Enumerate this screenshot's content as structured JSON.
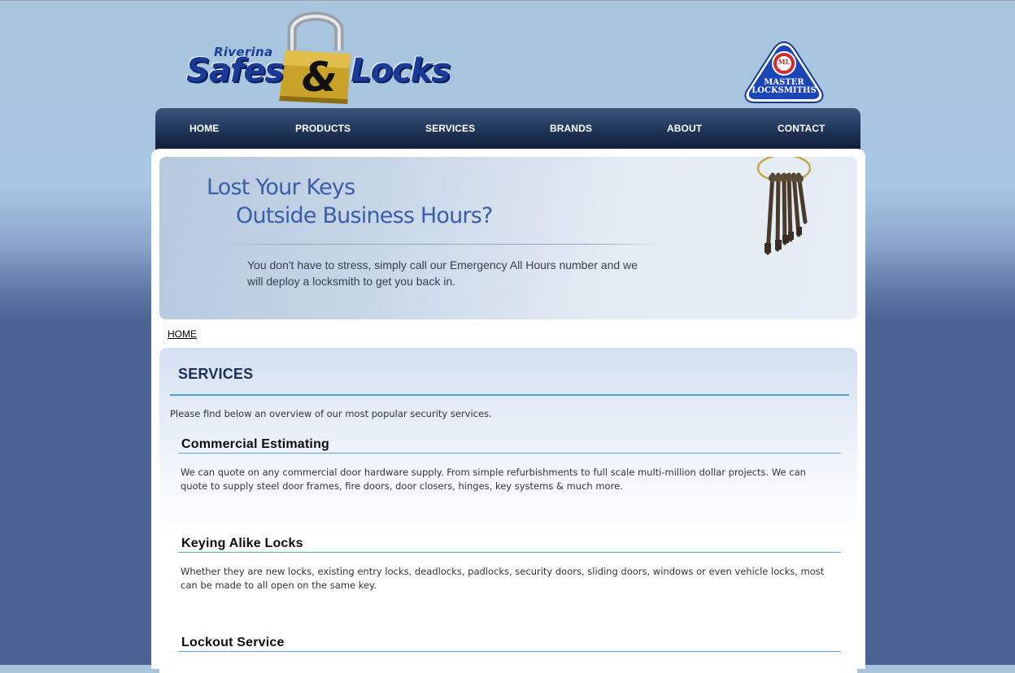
{
  "header": {
    "logo": {
      "line1": "Riverina",
      "word1": "Safes",
      "amp": "&",
      "word2": "Locks"
    },
    "badge": {
      "line1": "MASTER",
      "line2": "LOCKSMITHS",
      "emblem": "ML"
    }
  },
  "nav": {
    "items": [
      {
        "label": "HOME"
      },
      {
        "label": "PRODUCTS"
      },
      {
        "label": "SERVICES"
      },
      {
        "label": "BRANDS"
      },
      {
        "label": "ABOUT"
      },
      {
        "label": "CONTACT"
      }
    ]
  },
  "banner": {
    "title_line1": "Lost Your Keys",
    "title_line2": "Outside Business Hours?",
    "body": "You don't have to stress, simply call our Emergency All Hours number and we will deploy a locksmith to get you back in.",
    "image_icon": "bunch-of-keys"
  },
  "breadcrumb": {
    "home": "HOME"
  },
  "content": {
    "title": "SERVICES",
    "intro": "Please find below an overview of our most popular security services.",
    "services": [
      {
        "title": "Commercial Estimating",
        "desc": "We can quote on any commercial door hardware supply. From simple refurbishments to full scale multi-million dollar projects. We can quote to supply steel door frames, fire doors, door closers, hinges, key systems & much more."
      },
      {
        "title": "Keying Alike Locks",
        "desc": "Whether they are new locks, existing entry locks, deadlocks, padlocks, security doors, sliding doors, windows or even vehicle locks, most can be made to all open on the same key."
      },
      {
        "title": "Lockout Service",
        "desc": ""
      }
    ]
  },
  "colors": {
    "nav_dark": "#1f3457",
    "title_blue": "#1c2f54",
    "rule_blue": "#4a9fd4",
    "banner_text_blue": "#3a5ea8"
  }
}
